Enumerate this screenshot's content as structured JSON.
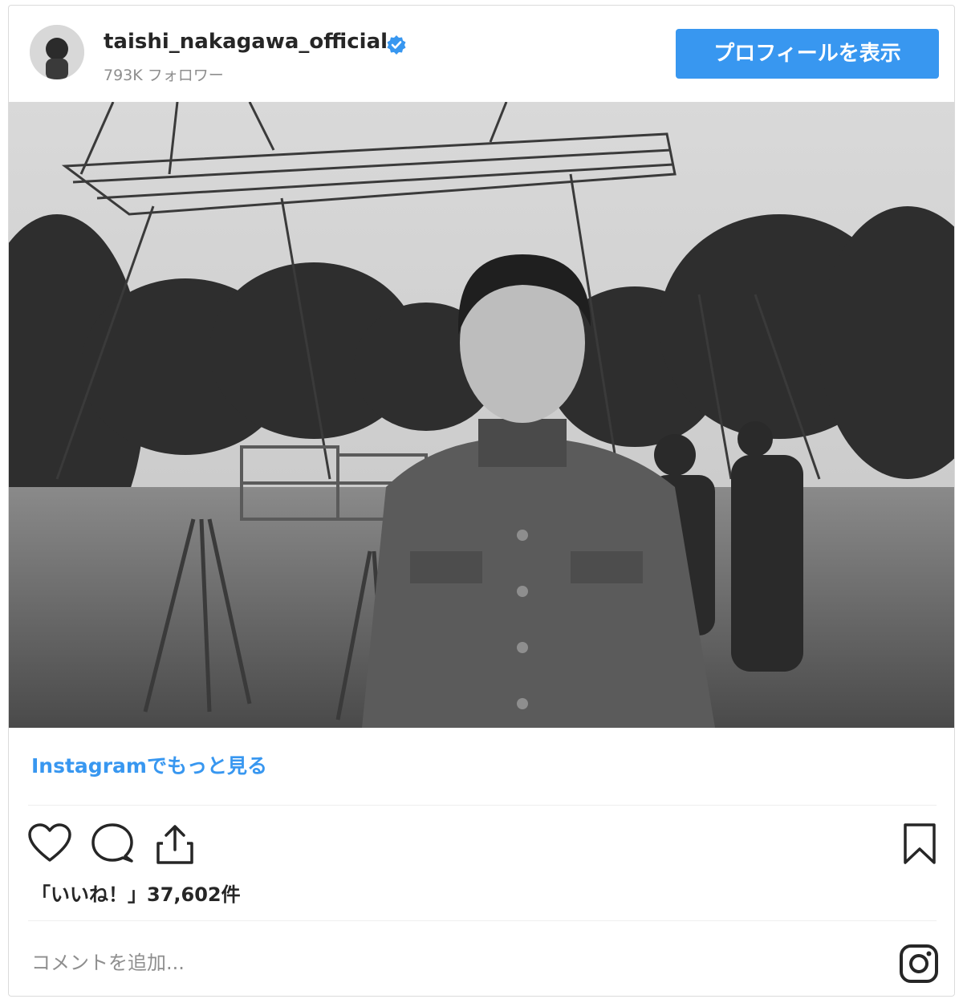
{
  "post": {
    "username": "taishi_nakagawa_official",
    "followers": "793K フォロワー",
    "profile_button": "プロフィールを表示",
    "more_link": "Instagramでもっと見る",
    "likes": "「いいね！」37,602件",
    "comment_placeholder": "コメントを追加...",
    "photo_style": "black-and-white film set photo",
    "colors": {
      "accent": "#3897f0",
      "text": "#262626",
      "muted": "#8e8e8e",
      "border": "#dbdbdb"
    },
    "icons": [
      "verified-badge-icon",
      "heart-icon",
      "comment-icon",
      "share-icon",
      "bookmark-icon",
      "instagram-logo-icon"
    ]
  }
}
